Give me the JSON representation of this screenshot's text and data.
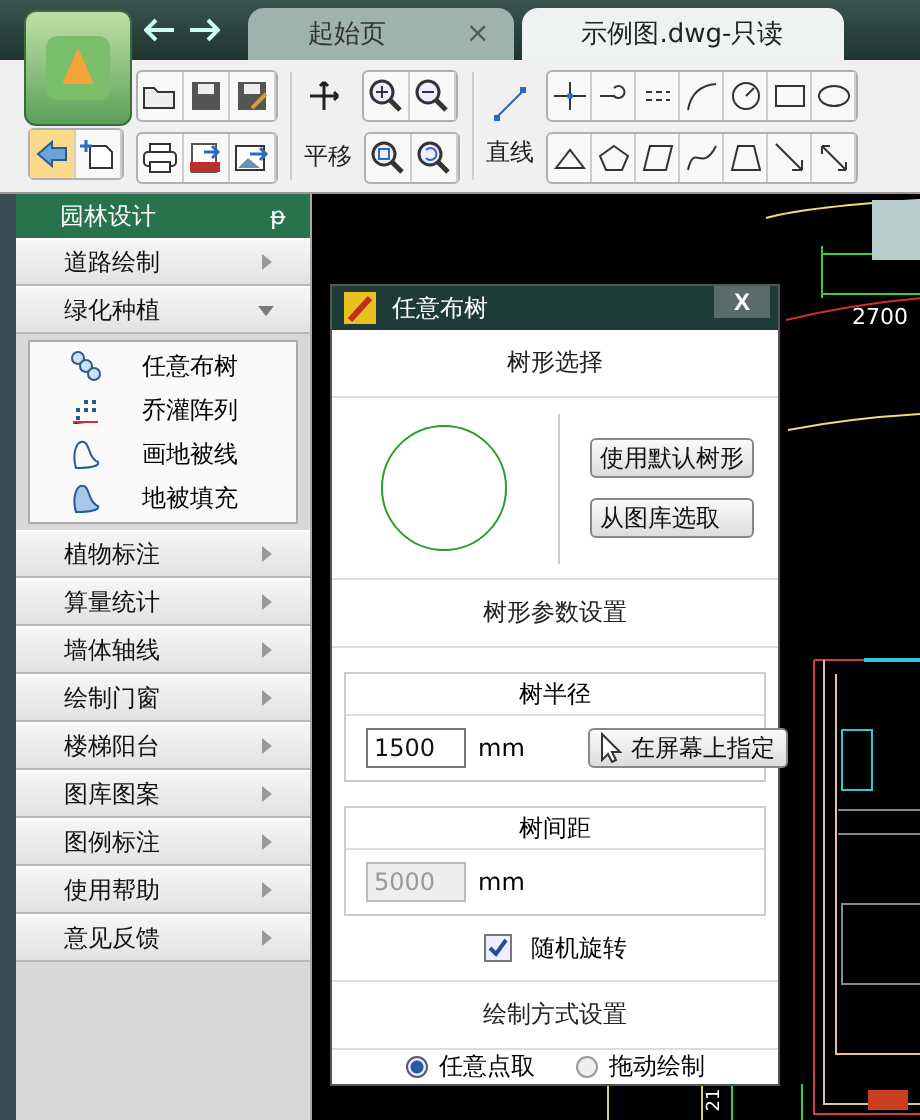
{
  "tabs": [
    {
      "label": "起始页",
      "selected": false,
      "close": "×"
    },
    {
      "label": "示例图.dwg-只读",
      "selected": true
    }
  ],
  "toolbar": {
    "pan_label": "平移",
    "line_label": "直线"
  },
  "sidebar": {
    "title": "园林设计",
    "pin": "ᵽ",
    "items": [
      {
        "label": "道路绘制",
        "expanded": false
      },
      {
        "label": "绿化种植",
        "expanded": true,
        "children": [
          {
            "label": "任意布树"
          },
          {
            "label": "乔灌阵列"
          },
          {
            "label": "画地被线"
          },
          {
            "label": "地被填充"
          }
        ]
      },
      {
        "label": "植物标注",
        "expanded": false
      },
      {
        "label": "算量统计",
        "expanded": false
      },
      {
        "label": "墙体轴线",
        "expanded": false
      },
      {
        "label": "绘制门窗",
        "expanded": false
      },
      {
        "label": "楼梯阳台",
        "expanded": false
      },
      {
        "label": "图库图案",
        "expanded": false
      },
      {
        "label": "图例标注",
        "expanded": false
      },
      {
        "label": "使用帮助",
        "expanded": false
      },
      {
        "label": "意见反馈",
        "expanded": false
      }
    ]
  },
  "canvas": {
    "dimension": "2700",
    "mark": "21"
  },
  "dialog": {
    "title": "任意布树",
    "close": "X",
    "shape_section": "树形选择",
    "shape_buttons": [
      "使用默认树形",
      "从图库选取"
    ],
    "param_section": "树形参数设置",
    "radius": {
      "label": "树半径",
      "value": "1500",
      "unit": "mm",
      "button": "在屏幕上指定",
      "disabled": false
    },
    "spacing": {
      "label": "树间距",
      "value": "5000",
      "unit": "mm",
      "disabled": true
    },
    "random_rotate": {
      "label": "随机旋转",
      "checked": true
    },
    "mode_section": "绘制方式设置",
    "modes": [
      {
        "label": "任意点取",
        "selected": true
      },
      {
        "label": "拖动绘制",
        "selected": false
      }
    ]
  }
}
